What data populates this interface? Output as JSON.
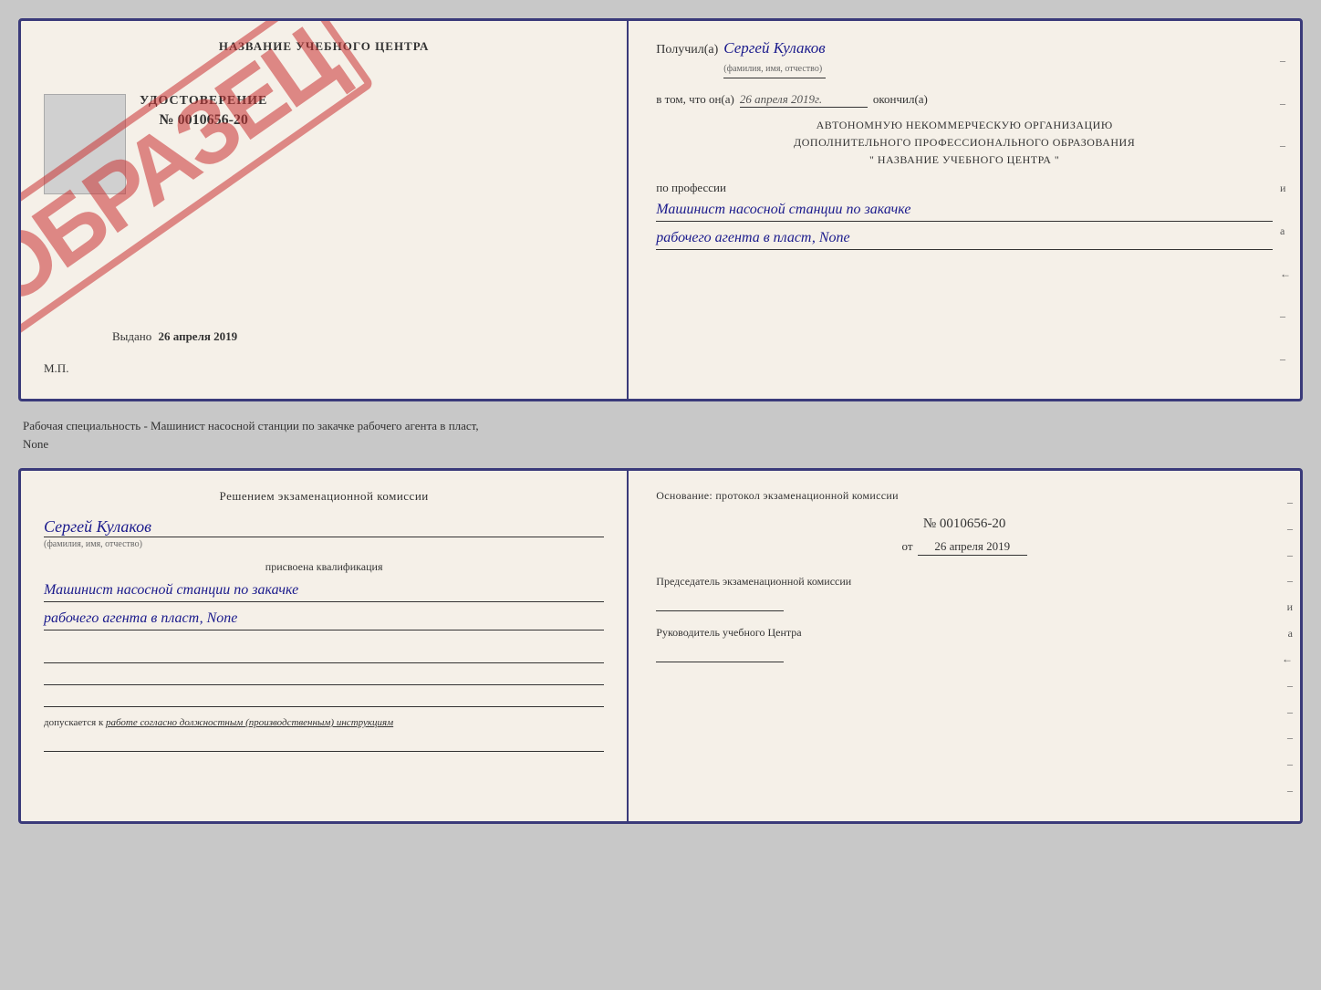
{
  "background": "#c8c8c8",
  "between_text": {
    "line1": "Рабочая специальность - Машинист насосной станции по закачке рабочего агента в пласт,",
    "line2": "None"
  },
  "top_doc": {
    "left": {
      "title": "НАЗВАНИЕ УЧЕБНОГО ЦЕНТРА",
      "udostoverenie_title": "УДОСТОВЕРЕНИЕ",
      "udostoverenie_num": "№ 0010656-20",
      "vydano_label": "Выдано",
      "vydano_date": "26 апреля 2019",
      "mp_label": "М.П.",
      "obrazets": "ОБРАЗЕЦ",
      "photo_placeholder": ""
    },
    "right": {
      "poluchil_label": "Получил(а)",
      "poluchil_name": "Сергей Кулаков",
      "poluchil_subtitle": "(фамилия, имя, отчество)",
      "vtom_label": "в том, что он(а)",
      "vtom_date": "26 апреля 2019г.",
      "okoncnil_label": "окончил(а)",
      "org_line1": "АВТОНОМНУЮ НЕКОММЕРЧЕСКУЮ ОРГАНИЗАЦИЮ",
      "org_line2": "ДОПОЛНИТЕЛЬНОГО ПРОФЕССИОНАЛЬНОГО ОБРАЗОВАНИЯ",
      "org_line3": "\"  НАЗВАНИЕ УЧЕБНОГО ЦЕНТРА  \"",
      "po_professii_label": "по профессии",
      "profession_line1": "Машинист насосной станции по закачке",
      "profession_line2": "рабочего агента в пласт, None",
      "side_dashes": [
        "-",
        "-",
        "-",
        "и",
        "а",
        "←",
        "-",
        "-",
        "-",
        "-"
      ]
    }
  },
  "bottom_doc": {
    "left": {
      "resheniem_title": "Решением экзаменационной комиссии",
      "fio_cursive": "Сергей Кулаков",
      "fio_subtitle": "(фамилия, имя, отчество)",
      "prisvoena_label": "присвоена квалификация",
      "qual_line1": "Машинист насосной станции по закачке",
      "qual_line2": "рабочего агента в пласт, None",
      "dopuskaetsya_prefix": "допускается к",
      "dopuskaetsya_italic": "работе согласно должностным (производственным) инструкциям"
    },
    "right": {
      "osnovanie_title": "Основание: протокол экзаменационной комиссии",
      "protocol_num": "№ 0010656-20",
      "protocol_from": "от",
      "protocol_date": "26 апреля 2019",
      "chairman_label": "Председатель экзаменационной комиссии",
      "rukovoditel_label": "Руководитель учебного Центра",
      "side_dashes": [
        "-",
        "-",
        "-",
        "-",
        "и",
        "а",
        "←",
        "-",
        "-",
        "-",
        "-",
        "-"
      ]
    }
  }
}
